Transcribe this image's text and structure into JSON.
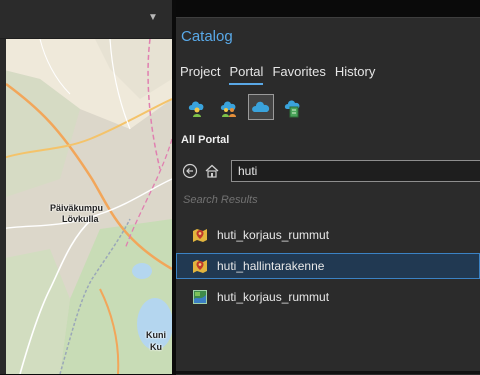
{
  "catalog": {
    "title": "Catalog",
    "tabs": [
      {
        "label": "Project",
        "active": false
      },
      {
        "label": "Portal",
        "active": true
      },
      {
        "label": "Favorites",
        "active": false
      },
      {
        "label": "History",
        "active": false
      }
    ],
    "portal_icons": [
      "my-content-icon",
      "groups-icon",
      "all-portal-icon",
      "living-atlas-icon"
    ],
    "section_label": "All Portal",
    "search": {
      "value": "huti"
    },
    "results_heading": "Search Results",
    "results": [
      {
        "label": "huti_korjaus_rummut",
        "icon": "feature-layer-icon",
        "selected": false
      },
      {
        "label": "huti_hallintarakenne",
        "icon": "feature-layer-icon",
        "selected": true
      },
      {
        "label": "huti_korjaus_rummut",
        "icon": "map-package-icon",
        "selected": false
      }
    ]
  },
  "map": {
    "labels": {
      "place1": "Päiväkumpu",
      "place2": "Lövkulla",
      "place3": "Kuni",
      "place4": "Ku"
    }
  },
  "colors": {
    "accent": "#59a9e8",
    "selection": "#213952",
    "panel": "#2b2b2b"
  }
}
